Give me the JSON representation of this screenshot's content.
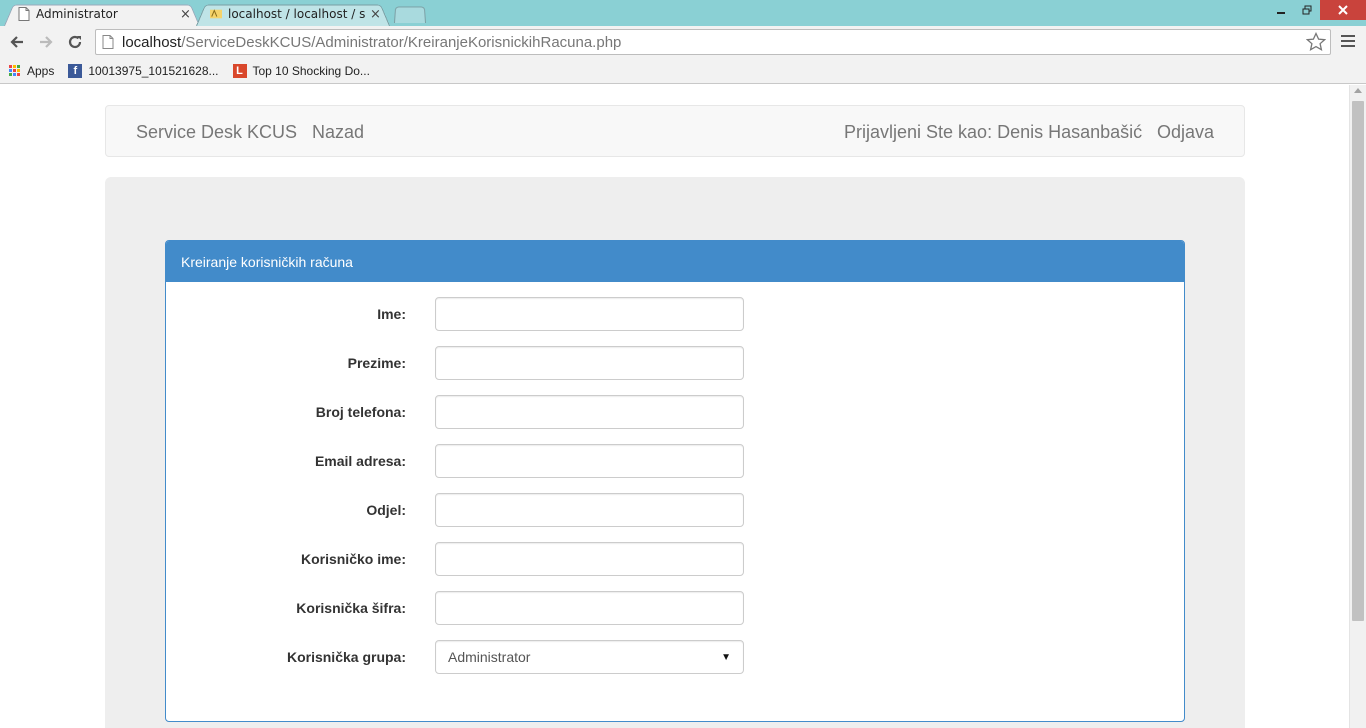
{
  "browser": {
    "tabs": [
      {
        "title": "Administrator",
        "close": "×"
      },
      {
        "title": "localhost / localhost / serv",
        "close": "×"
      }
    ],
    "url_host": "localhost",
    "url_path": "/ServiceDeskKCUS/Administrator/KreiranjeKorisnickihRacuna.php",
    "bookmarks": [
      {
        "label": "Apps"
      },
      {
        "label": "10013975_101521628..."
      },
      {
        "label": "Top 10 Shocking Do..."
      }
    ]
  },
  "navbar": {
    "brand": "Service Desk KCUS",
    "back": "Nazad",
    "logged_in": "Prijavljeni Ste kao: Denis Hasanbašić",
    "logout": "Odjava"
  },
  "panel": {
    "title": "Kreiranje korisničkih računa"
  },
  "form": {
    "fields": [
      {
        "label": "Ime:",
        "value": ""
      },
      {
        "label": "Prezime:",
        "value": ""
      },
      {
        "label": "Broj telefona:",
        "value": ""
      },
      {
        "label": "Email adresa:",
        "value": ""
      },
      {
        "label": "Odjel:",
        "value": ""
      },
      {
        "label": "Korisničko ime:",
        "value": ""
      },
      {
        "label": "Korisnička šifra:",
        "value": ""
      },
      {
        "label": "Korisnička grupa:",
        "value": "Administrator"
      }
    ]
  },
  "colors": {
    "titlebar": "#8ad0d4",
    "panel_primary": "#428bca",
    "jumbotron": "#eeeeee",
    "close_button": "#c9433c"
  }
}
